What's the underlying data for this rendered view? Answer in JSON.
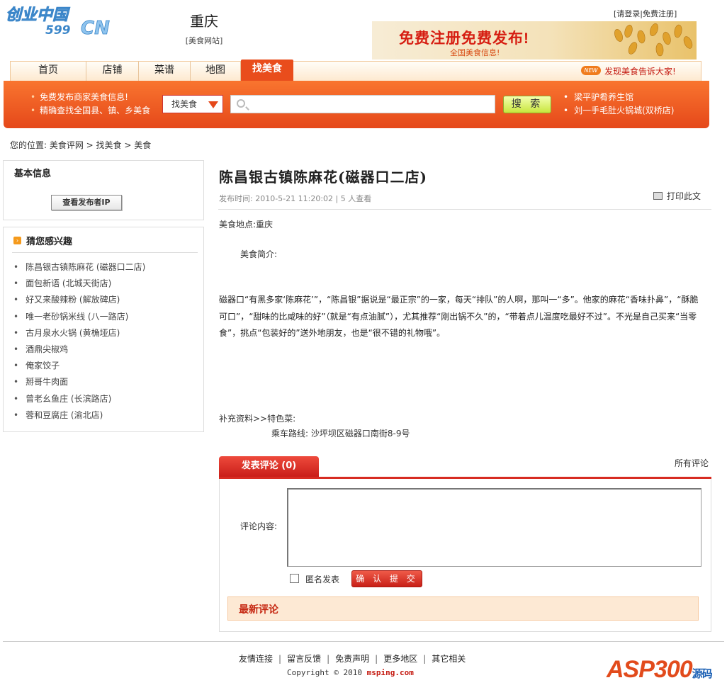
{
  "header": {
    "logo_text": "创业中国",
    "logo_sub": "599",
    "logo_cn": "CN",
    "city": "重庆",
    "city_sub": "[美食网站]",
    "top_links": "[请登录|免费注册]",
    "banner_title": "免费注册免费发布!",
    "banner_sub": "全国美食信息!"
  },
  "nav": {
    "items": [
      "首页",
      "店铺",
      "菜谱",
      "地图"
    ],
    "active": "找美食",
    "new_badge": "NEW",
    "promo": "发现美食告诉大家!"
  },
  "search": {
    "tips": [
      "免费发布商家美食信息!",
      "精确查找全国县、镇、乡美食"
    ],
    "select_value": "找美食",
    "input_value": "",
    "button": "搜 索",
    "hot": [
      "梁平驴肴养生馆",
      "刘一手毛肚火锅城(双桥店)"
    ]
  },
  "breadcrumb": "您的位置: 美食评网 > 找美食 > 美食",
  "sidebar": {
    "basic_title": "基本信息",
    "ip_button": "查看发布者IP",
    "rec_title": "猜您感兴趣",
    "rec_items": [
      "陈昌银古镇陈麻花 (磁器口二店)",
      "面包新语 (北城天街店)",
      "好又来酸辣粉 (解放碑店)",
      "唯一老砂锅米线 (八一路店)",
      "古月泉水火锅 (黄桷垭店)",
      "酒鼎尖椒鸡",
      "俺家饺子",
      "掰哥牛肉面",
      "曾老幺鱼庄 (长滨路店)",
      "蓉和豆腐庄 (渝北店)"
    ]
  },
  "article": {
    "title": "陈昌银古镇陈麻花(磁器口二店)",
    "meta": "发布时间: 2010-5-21 11:20:02 | 5 人查看",
    "print": "打印此文",
    "place": "美食地点:重庆",
    "intro": "美食简介:",
    "body": "磁器口“有黑多家‘陈麻花’”，“陈昌银”据说是“最正宗”的一家，每天“排队”的人啊，那叫一“多”。他家的麻花“香味扑鼻”，“酥脆可口”，“甜味的比咸味的好”（就是“有点油腻”），尤其推荐“刚出锅不久”的，“带着点儿温度吃最好不过”。不光是自己买来“当零食”，挑点“包装好的”送外地朋友，也是“很不错的礼物哦”。",
    "extra": "补充资料>>特色菜:",
    "route": "乘车路线: 沙坪坝区磁器口南街8-9号"
  },
  "comments": {
    "tab": "发表评论 (0)",
    "all": "所有评论",
    "label": "评论内容:",
    "textarea_value": "",
    "anon": "匿名发表",
    "submit": "确 认 提 交",
    "latest": "最新评论"
  },
  "footer": {
    "links": [
      "友情连接",
      "留言反馈",
      "免责声明",
      "更多地区",
      "其它相关"
    ],
    "copy_prefix": "Copyright © 2010",
    "copy_site": "msping.com",
    "watermark": "ASP300",
    "watermark_sub": "源码"
  }
}
